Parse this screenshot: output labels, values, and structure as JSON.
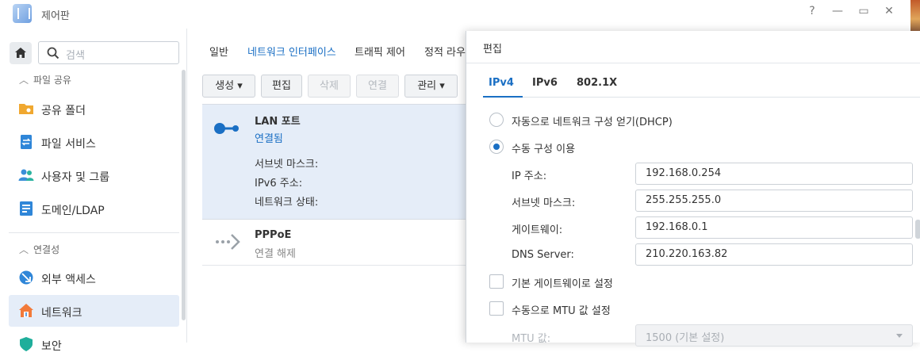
{
  "window": {
    "title": "제어판",
    "controls": [
      "?",
      "—",
      "▭",
      "✕"
    ]
  },
  "sidebar": {
    "search_placeholder": "검색",
    "sections": [
      {
        "label": "파일 공유",
        "items": [
          {
            "label": "공유 폴더",
            "icon": "folder-share-icon"
          },
          {
            "label": "파일 서비스",
            "icon": "file-services-icon"
          },
          {
            "label": "사용자 및 그룹",
            "icon": "users-icon"
          },
          {
            "label": "도메인/LDAP",
            "icon": "domain-icon"
          }
        ]
      },
      {
        "label": "연결성",
        "items": [
          {
            "label": "외부 액세스",
            "icon": "external-access-icon"
          },
          {
            "label": "네트워크",
            "icon": "network-house-icon",
            "active": true
          },
          {
            "label": "보안",
            "icon": "shield-icon"
          }
        ]
      }
    ]
  },
  "main": {
    "tabs": [
      "일반",
      "네트워크 인터페이스",
      "트래픽 제어",
      "정적 라우"
    ],
    "active_tab": 1,
    "toolbar": {
      "create": "생성",
      "edit": "편집",
      "delete": "삭제",
      "connect": "연결",
      "manage": "관리"
    },
    "interfaces": [
      {
        "name": "LAN 포트",
        "status": "연결됨",
        "status_color": "#1a6fc4",
        "props": [
          "서브넷 마스크:",
          "IPv6 주소:",
          "네트워크 상태:"
        ]
      },
      {
        "name": "PPPoE",
        "status": "연결 해제",
        "status_color": "#888888"
      }
    ]
  },
  "dialog": {
    "title": "편집",
    "tabs": [
      "IPv4",
      "IPv6",
      "802.1X"
    ],
    "active_tab": 0,
    "dhcp_label": "자동으로 네트워크 구성 얻기(DHCP)",
    "manual_label": "수동 구성 이용",
    "fields": {
      "ip_label": "IP 주소:",
      "ip_value": "192.168.0.254",
      "mask_label": "서브넷 마스크:",
      "mask_value": "255.255.255.0",
      "gateway_label": "게이트웨이:",
      "gateway_value": "192.168.0.1",
      "dns_label": "DNS Server:",
      "dns_value": "210.220.163.82"
    },
    "default_gateway_label": "기본 게이트웨이로 설정",
    "manual_mtu_label": "수동으로 MTU 값 설정",
    "mtu_label": "MTU 값:",
    "mtu_value": "1500 (기본 설정)"
  },
  "colors": {
    "accent": "#1a6fc4",
    "selected_row": "#e5edf8"
  }
}
